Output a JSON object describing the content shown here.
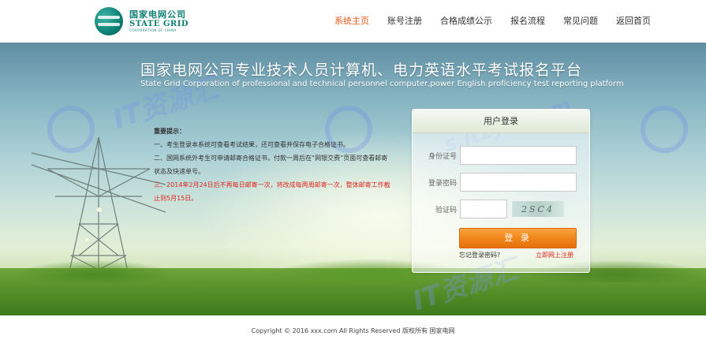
{
  "header": {
    "logo": {
      "name_cn": "国家电网公司",
      "name_en": "STATE GRID",
      "sub_en": "CORPORATION OF CHINA"
    },
    "nav": [
      {
        "label": "系统主页",
        "active": true
      },
      {
        "label": "账号注册",
        "active": false
      },
      {
        "label": "合格成绩公示",
        "active": false
      },
      {
        "label": "报名流程",
        "active": false
      },
      {
        "label": "常见问题",
        "active": false
      },
      {
        "label": "返回首页",
        "active": false
      }
    ]
  },
  "banner": {
    "title_cn": "国家电网公司专业技术人员计算机、电力英语水平考试报名平台",
    "title_en": "State Grid Corporation of professional and technical personnel computer,power English proficiency test reporting platform",
    "watermarks": [
      "IT资源汇",
      "s.itzyh.com",
      "IT资源汇",
      "itzyh.com"
    ]
  },
  "notice": {
    "heading": "重要提示：",
    "items": [
      "一、考生登录本系统可查看考试结果，还可查看并保存电子合格证书。",
      "二、国网系统外考生可申请邮寄合格证书，付款一周后在“网银交费”页面可查看邮寄状态及快递单号。"
    ],
    "alert": "三、2014年2月24日后不再每日邮寄一次，将改成每两周邮寄一次，整体邮寄工作截止到5月15日。"
  },
  "login": {
    "title": "用户登录",
    "id_label": "身份证号",
    "id_value": "",
    "password_label": "登录密码",
    "password_value": "",
    "code_label": "验证码",
    "code_value": "",
    "captcha_text": "2SC4",
    "submit_label": "登 录",
    "forgot_label": "忘记登录密码?",
    "register_label": "立即网上注册"
  },
  "footer": {
    "text": "Copyright © 2016 xxx.com All Rights Reserved    版权所有 国家电网"
  },
  "colors": {
    "accent": "#e85a1c",
    "brand": "#0d7f73",
    "button": "#f08419",
    "alert": "#e1261c"
  }
}
